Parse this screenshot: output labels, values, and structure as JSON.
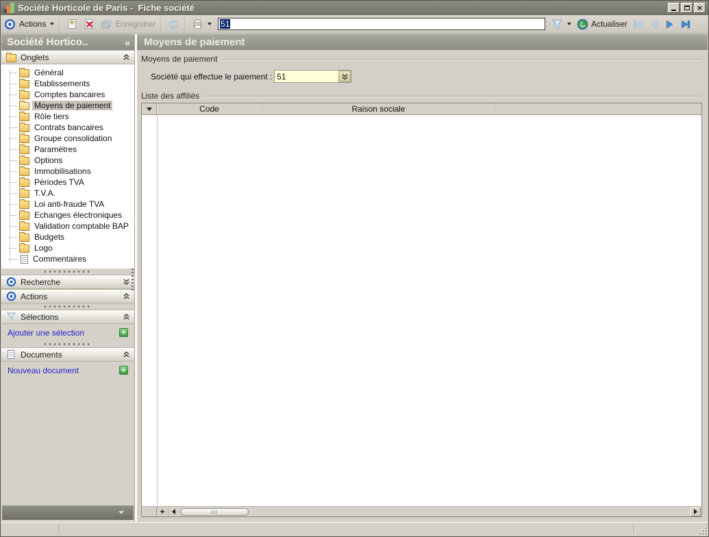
{
  "window": {
    "title": "Société Horticole de Paris -  Fiche société"
  },
  "toolbar": {
    "actions_label": "Actions",
    "enregistrer_label": "Enregistrer",
    "record_value": "51",
    "actualiser_label": "Actualiser"
  },
  "sidebar": {
    "header_title": "Société Hortico..",
    "collapse_glyph": "«",
    "onglets": {
      "label": "Onglets",
      "items": [
        {
          "label": "Général",
          "icon": "folder"
        },
        {
          "label": "Etablissements",
          "icon": "folder"
        },
        {
          "label": "Comptes bancaires",
          "icon": "folder"
        },
        {
          "label": "Moyens de paiement",
          "icon": "folder-open",
          "selected": true
        },
        {
          "label": "Rôle tiers",
          "icon": "folder"
        },
        {
          "label": "Contrats bancaires",
          "icon": "folder"
        },
        {
          "label": "Groupe consolidation",
          "icon": "folder"
        },
        {
          "label": "Paramètres",
          "icon": "folder"
        },
        {
          "label": "Options",
          "icon": "folder"
        },
        {
          "label": "Immobilisations",
          "icon": "folder"
        },
        {
          "label": "Périodes TVA",
          "icon": "folder"
        },
        {
          "label": "T.V.A.",
          "icon": "folder"
        },
        {
          "label": "Loi anti-fraude TVA",
          "icon": "folder"
        },
        {
          "label": "Echanges électroniques",
          "icon": "folder"
        },
        {
          "label": "Validation comptable BAP",
          "icon": "folder"
        },
        {
          "label": "Budgets",
          "icon": "folder"
        },
        {
          "label": "Logo",
          "icon": "folder"
        },
        {
          "label": "Commentaires",
          "icon": "note"
        }
      ]
    },
    "sections": {
      "recherche": {
        "label": "Recherche"
      },
      "actions": {
        "label": "Actions"
      },
      "selections": {
        "label": "Sélections",
        "link": "Ajouter une sélection",
        "add_glyph": "+"
      },
      "documents": {
        "label": "Documents",
        "link": "Nouveau document",
        "add_glyph": "+"
      }
    }
  },
  "main": {
    "header_title": "Moyens de paiement",
    "group_paiement_label": "Moyens de paiement",
    "payer_label": "Société qui effectue le paiement :",
    "payer_value": "51",
    "group_affilies_label": "Liste des affiliés",
    "table": {
      "columns": [
        "Code",
        "Raison sociale"
      ],
      "rows": []
    },
    "plus_glyph": "+"
  },
  "colors": {
    "link_blue": "#2222cc",
    "field_yellow": "#ffffd8",
    "selection_blue": "#0a246a",
    "add_green": "#3f9b3f",
    "folder_yellow": "#eec05f"
  }
}
